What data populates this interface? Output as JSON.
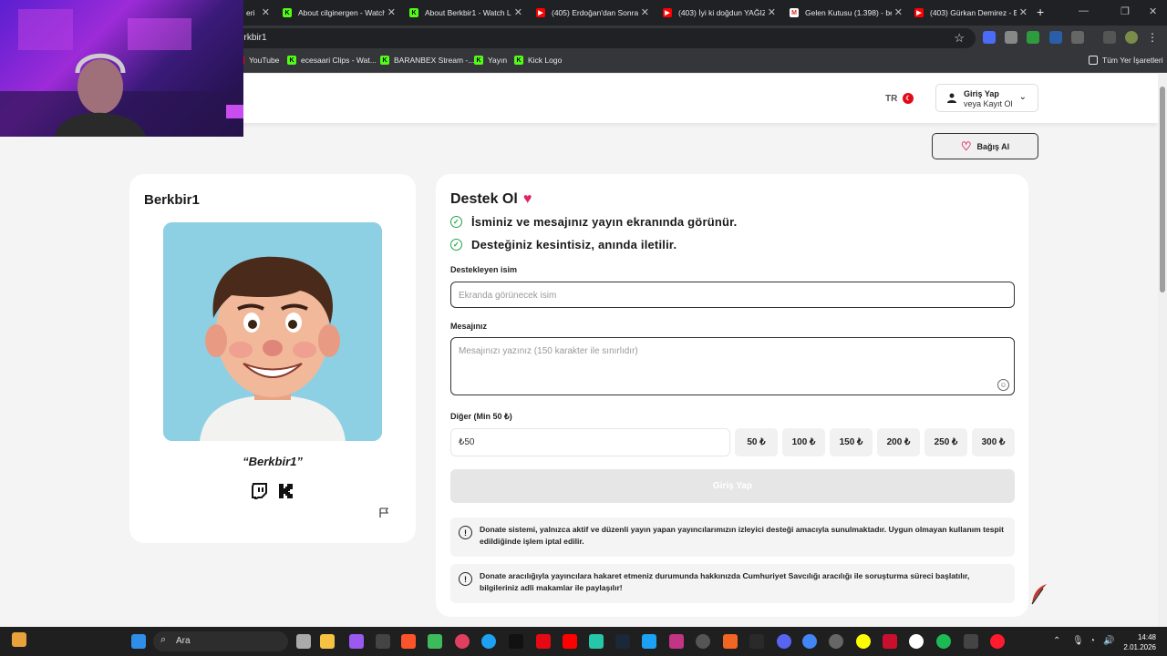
{
  "browser": {
    "tabs": [
      {
        "label": "eri",
        "icon": "kick"
      },
      {
        "label": "About cilginergen - Watch",
        "icon": "kick"
      },
      {
        "label": "About Berkbir1 - Watch Li",
        "icon": "kick"
      },
      {
        "label": "(405) Erdoğan'dan Sonra",
        "icon": "youtube"
      },
      {
        "label": "(403) İyi ki doğdun YAĞIZ",
        "icon": "youtube"
      },
      {
        "label": "Gelen Kutusu (1.398) - be",
        "icon": "gmail"
      },
      {
        "label": "(403) Gürkan Demirez - B",
        "icon": "youtube"
      }
    ],
    "url": "erkbir1",
    "bookmarks": [
      {
        "label": "YouTube",
        "icon": "youtube"
      },
      {
        "label": "ecesaari Clips - Wat...",
        "icon": "kick"
      },
      {
        "label": "BARANBEX Stream -...",
        "icon": "kick"
      },
      {
        "label": "Yayın",
        "icon": "kick"
      },
      {
        "label": "Kick Logo",
        "icon": "kick"
      }
    ],
    "all_bookmarks_label": "Tüm Yer İşaretleri"
  },
  "header": {
    "lang": "TR",
    "login_title": "Giriş Yap",
    "login_sub": "veya Kayıt Ol"
  },
  "donate_button_label": "Bağış Al",
  "profile": {
    "name": "Berkbir1",
    "quote": "“Berkbir1”"
  },
  "form": {
    "title": "Destek Ol",
    "benefits": [
      "İsminiz ve mesajınız yayın ekranında görünür.",
      "Desteğiniz kesintisiz, anında iletilir."
    ],
    "name_label": "Destekleyen isim",
    "name_placeholder": "Ekranda görünecek isim",
    "message_label": "Mesajınız",
    "message_placeholder": "Mesajınızı yazınız (150 karakter ile sınırlıdır)",
    "amount_label": "Diğer (Min 50 ₺)",
    "amount_value": "₺50",
    "amounts": [
      "50 ₺",
      "100 ₺",
      "150 ₺",
      "200 ₺",
      "250 ₺",
      "300 ₺"
    ],
    "submit_label": "Giriş Yap",
    "notices": [
      "Donate sistemi, yalnızca aktif ve düzenli yayın yapan yayıncılarımızın izleyici desteği amacıyla sunulmaktadır. Uygun olmayan kullanım tespit edildiğinde işlem iptal edilir.",
      "Donate aracılığıyla yayıncılara hakaret etmeniz durumunda hakkınızda Cumhuriyet Savcılığı aracılığı ile soruşturma süreci başlatılır, bilgileriniz adli makamlar ile paylaşılır!"
    ]
  },
  "taskbar": {
    "search_label": "Ara",
    "time": "14:48",
    "date": "2.01.2026"
  },
  "colors": {
    "accent_heart": "#e0245e",
    "check_green": "#22a34a",
    "kick_green": "#53fc18"
  }
}
